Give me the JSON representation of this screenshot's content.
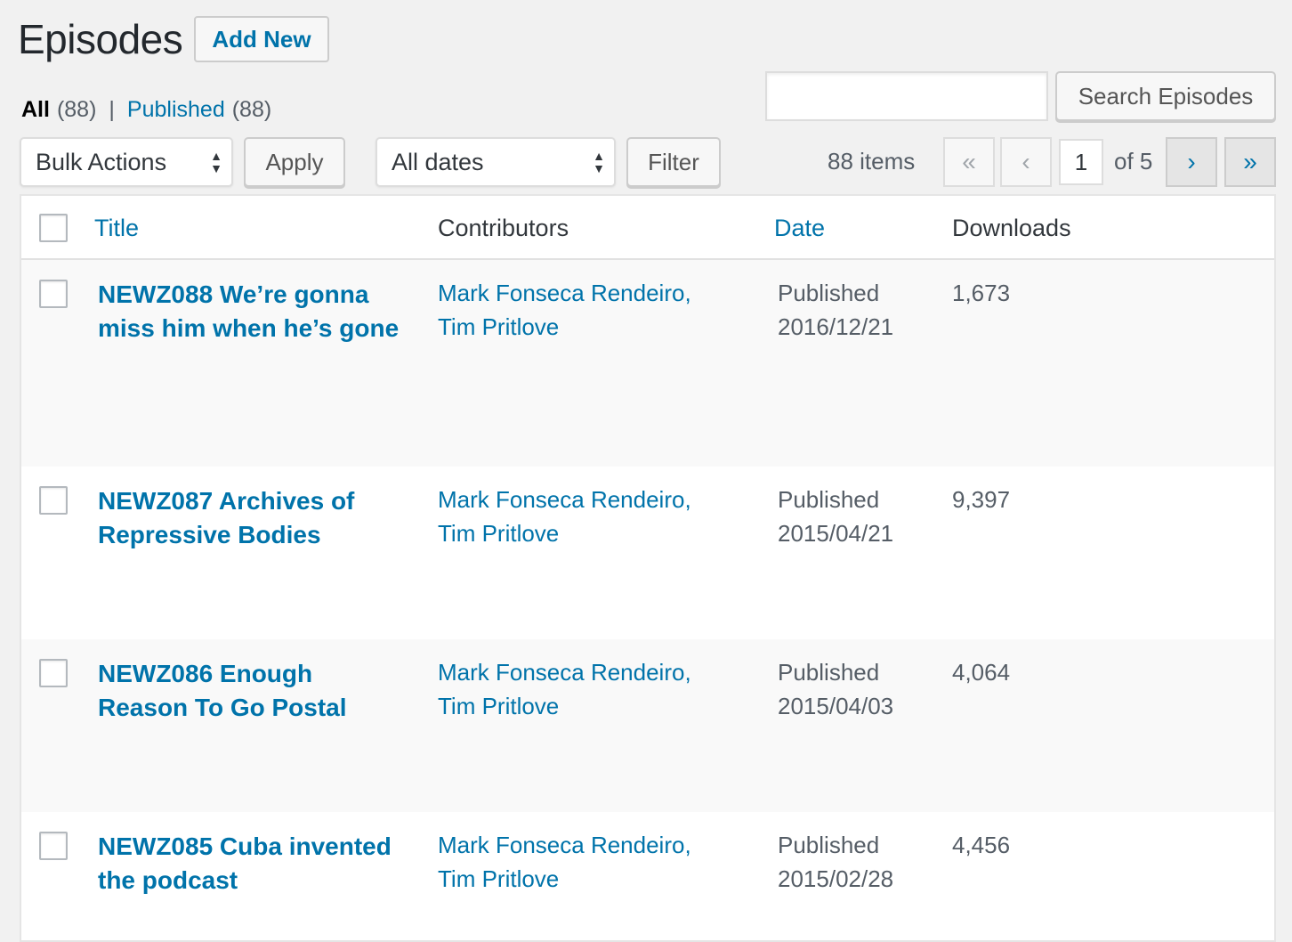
{
  "header": {
    "title": "Episodes",
    "add_new_label": "Add New"
  },
  "views": {
    "all_label": "All",
    "all_count": "(88)",
    "separator": "|",
    "published_label": "Published",
    "published_count": "(88)"
  },
  "search": {
    "value": "",
    "button_label": "Search Episodes"
  },
  "tablenav": {
    "bulk_actions_label": "Bulk Actions",
    "apply_label": "Apply",
    "dates_label": "All dates",
    "filter_label": "Filter",
    "items_count": "88 items",
    "first_page": "«",
    "prev_page": "‹",
    "current_page": "1",
    "of_pages": "of 5",
    "next_page": "›",
    "last_page": "»"
  },
  "table": {
    "columns": {
      "title": "Title",
      "contributors": "Contributors",
      "date": "Date",
      "downloads": "Downloads"
    },
    "rows": [
      {
        "title": "NEWZ088 We’re gonna miss him when he’s gone",
        "contributor_1": "Mark Fonseca Rendeiro,",
        "contributor_2": "Tim Pritlove",
        "status": "Published",
        "date": "2016/12/21",
        "downloads": "1,673"
      },
      {
        "title": "NEWZ087 Archives of Repressive Bodies",
        "contributor_1": "Mark Fonseca Rendeiro,",
        "contributor_2": "Tim Pritlove",
        "status": "Published",
        "date": "2015/04/21",
        "downloads": "9,397"
      },
      {
        "title": "NEWZ086 Enough Reason To Go Postal",
        "contributor_1": "Mark Fonseca Rendeiro,",
        "contributor_2": "Tim Pritlove",
        "status": "Published",
        "date": "2015/04/03",
        "downloads": "4,064"
      },
      {
        "title": "NEWZ085 Cuba invented the podcast",
        "contributor_1": "Mark Fonseca Rendeiro,",
        "contributor_2": "Tim Pritlove",
        "status": "Published",
        "date": "2015/02/28",
        "downloads": "4,456"
      }
    ]
  }
}
